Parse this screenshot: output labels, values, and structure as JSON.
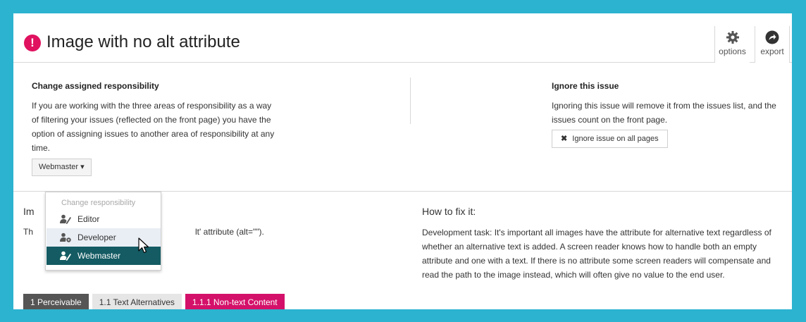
{
  "header": {
    "alert_glyph": "!",
    "title": "Image with no alt attribute",
    "options_label": "options",
    "export_label": "export"
  },
  "responsibility": {
    "heading": "Change assigned responsibility",
    "description": "If you are working with the three areas of responsibility as a way of filtering your issues (reflected on the front page) you have the option of assigning issues to another area of responsibility at any time.",
    "current_value": "Webmaster",
    "dropdown": {
      "header": "Change responsibility",
      "items": [
        {
          "label": "Editor",
          "icon": "user-pen-icon"
        },
        {
          "label": "Developer",
          "icon": "user-gear-icon"
        },
        {
          "label": "Webmaster",
          "icon": "user-pen-icon"
        }
      ],
      "hovered": "Developer",
      "selected": "Webmaster"
    }
  },
  "ignore": {
    "heading": "Ignore this issue",
    "description": "Ignoring this issue will remove it from the issues list, and the issues count on the front page.",
    "button_label": "Ignore issue on all pages"
  },
  "impact": {
    "heading_visible": "Im",
    "text_visible_start": "Th",
    "text_visible_end": "lt' attribute (alt=\"\")."
  },
  "fix": {
    "heading": "How to fix it:",
    "text": "Development task: It's important all images have the attribute for alternative text regardless of whether an alternative text is added. A screen reader knows how to handle both an empty attribute and one with a text. If there is no attribute some screen readers will compensate and read the path to the image instead, which will often give no value to the end user."
  },
  "breadcrumbs": [
    "1 Perceivable",
    "1.1 Text Alternatives",
    "1.1.1 Non-text Content"
  ],
  "colors": {
    "frame": "#2cb3d0",
    "alert": "#e0115f",
    "crumb_dark": "#555555",
    "crumb_light": "#e6e6e6",
    "crumb_accent": "#d4116a",
    "selected_item": "#145b63",
    "hover_item": "#e9eef4"
  }
}
